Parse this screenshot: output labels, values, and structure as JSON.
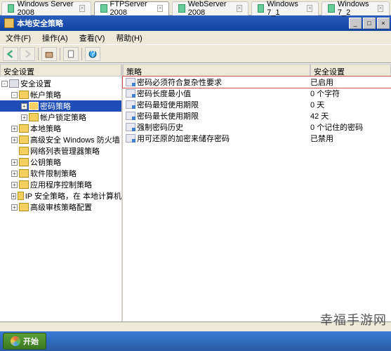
{
  "tabs": [
    {
      "label": "Windows Server 2008"
    },
    {
      "label": "FTPServer 2008"
    },
    {
      "label": "WebServer 2008"
    },
    {
      "label": "Windows 7_1"
    },
    {
      "label": "Windows 7_2"
    }
  ],
  "window": {
    "title": "本地安全策略",
    "min": "_",
    "max": "□",
    "close": "×"
  },
  "menu": {
    "file": "文件(F)",
    "action": "操作(A)",
    "view": "查看(V)",
    "help": "帮助(H)"
  },
  "tree": {
    "header": "安全设置",
    "root": "安全设置",
    "items": [
      {
        "exp": "-",
        "indent": 1,
        "label": "帐户策略"
      },
      {
        "exp": "+",
        "indent": 2,
        "label": "密码策略",
        "selected": true
      },
      {
        "exp": "+",
        "indent": 2,
        "label": "帐户锁定策略"
      },
      {
        "exp": "+",
        "indent": 1,
        "label": "本地策略"
      },
      {
        "exp": "+",
        "indent": 1,
        "label": "高级安全 Windows 防火墙"
      },
      {
        "exp": "",
        "indent": 1,
        "label": "网络列表管理器策略"
      },
      {
        "exp": "+",
        "indent": 1,
        "label": "公钥策略"
      },
      {
        "exp": "+",
        "indent": 1,
        "label": "软件限制策略"
      },
      {
        "exp": "+",
        "indent": 1,
        "label": "应用程序控制策略"
      },
      {
        "exp": "+",
        "indent": 1,
        "label": "IP 安全策略，在 本地计算机"
      },
      {
        "exp": "+",
        "indent": 1,
        "label": "高级审核策略配置"
      }
    ]
  },
  "list": {
    "col1": "策略",
    "col2": "安全设置",
    "rows": [
      {
        "p": "密码必须符合复杂性要求",
        "v": "已启用",
        "hot": true
      },
      {
        "p": "密码长度最小值",
        "v": "0 个字符"
      },
      {
        "p": "密码最短使用期限",
        "v": "0 天"
      },
      {
        "p": "密码最长使用期限",
        "v": "42 天"
      },
      {
        "p": "强制密码历史",
        "v": "0 个记住的密码"
      },
      {
        "p": "用可还原的加密来储存密码",
        "v": "已禁用"
      }
    ]
  },
  "start": "开始",
  "watermark": "幸福手游网"
}
